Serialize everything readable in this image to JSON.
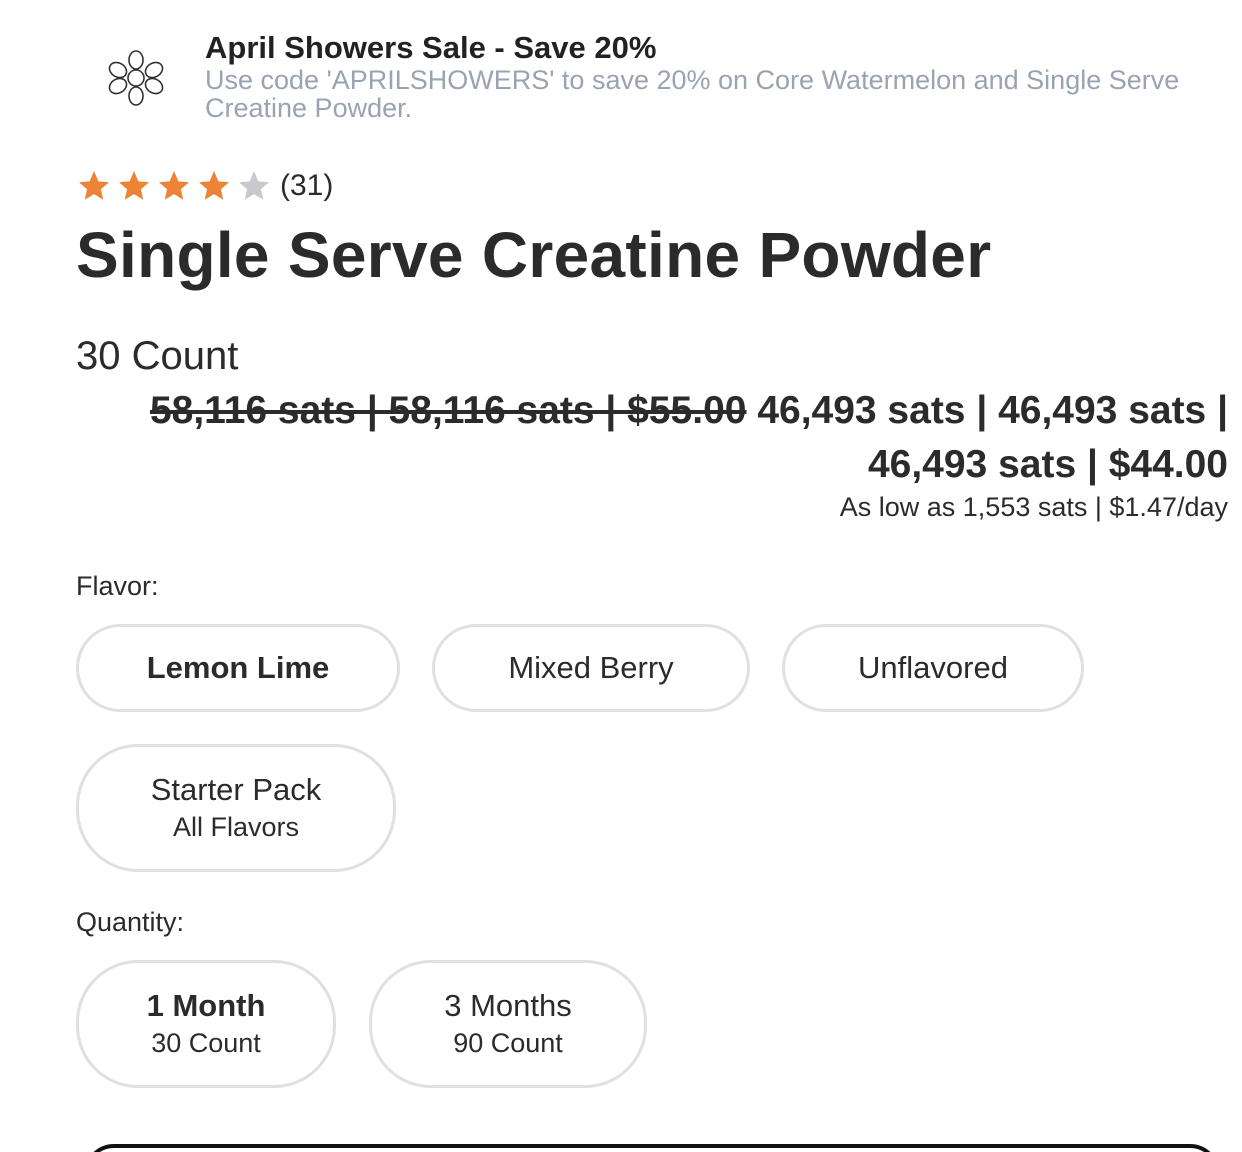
{
  "promo": {
    "title": "April Showers Sale - Save 20%",
    "text": "Use code 'APRILSHOWERS' to save 20% on Core Watermelon and Single Serve Creatine Powder.",
    "icon": "flower-icon"
  },
  "rating": {
    "stars": 4,
    "max_stars": 5,
    "review_count": "(31)",
    "star_color": "#ee8235",
    "empty_star_color": "#c7c9cc"
  },
  "product": {
    "title": "Single Serve Creatine Powder",
    "size": "30 Count"
  },
  "price": {
    "original": "58,116 sats | 58,116 sats | $55.00",
    "sale": "46,493 sats | 46,493 sats | 46,493 sats | $44.00",
    "per_day": "As low as 1,553 sats | $1.47/day"
  },
  "flavor": {
    "label": "Flavor:",
    "options": [
      {
        "label": "Lemon Lime",
        "selected": true
      },
      {
        "label": "Mixed Berry",
        "selected": false
      },
      {
        "label": "Unflavored",
        "selected": false
      },
      {
        "label": "Starter Pack",
        "sublabel": "All Flavors",
        "selected": false
      }
    ]
  },
  "quantity": {
    "label": "Quantity:",
    "options": [
      {
        "label": "1 Month",
        "sublabel": "30 Count",
        "selected": true
      },
      {
        "label": "3 Months",
        "sublabel": "90 Count",
        "selected": false
      }
    ]
  },
  "colors": {
    "text": "#2b2b2b",
    "muted": "#9aa3b2",
    "border": "#e0e0e0"
  }
}
